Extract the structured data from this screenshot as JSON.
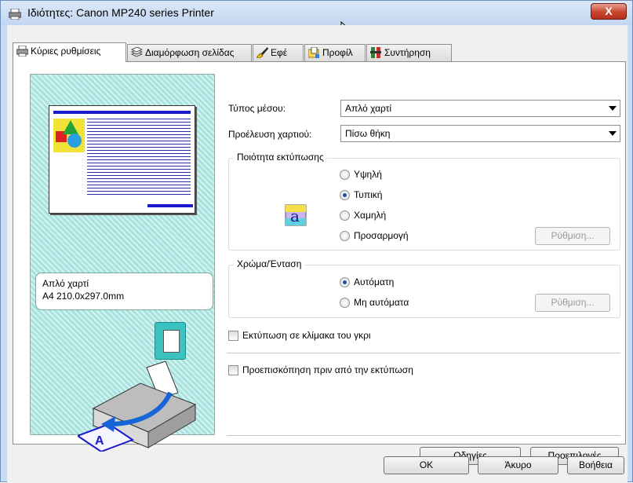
{
  "window": {
    "title": "Ιδιότητες: Canon MP240 series Printer",
    "close_label": "X"
  },
  "tabs": [
    {
      "label": "Κύριες ρυθμίσεις",
      "icon": "printer-icon"
    },
    {
      "label": "Διαμόρφωση σελίδας",
      "icon": "pages-icon"
    },
    {
      "label": "Εφέ",
      "icon": "brush-icon"
    },
    {
      "label": "Προφίλ",
      "icon": "folder-icon"
    },
    {
      "label": "Συντήρηση",
      "icon": "tools-icon"
    }
  ],
  "preview": {
    "media_name": "Απλό χαρτί",
    "media_size": "A4 210.0x297.0mm"
  },
  "settings": {
    "media_type_label": "Τύπος μέσου:",
    "media_type_value": "Απλό χαρτί",
    "paper_source_label": "Προέλευση χαρτιού:",
    "paper_source_value": "Πίσω θήκη"
  },
  "quality": {
    "title": "Ποιότητα εκτύπωσης",
    "options": [
      "Υψηλή",
      "Τυπική",
      "Χαμηλή",
      "Προσαρμογή"
    ],
    "selected": "Τυπική",
    "set_button": "Ρύθμιση..."
  },
  "color": {
    "title": "Χρώμα/Ένταση",
    "options": [
      "Αυτόματη",
      "Μη αυτόματα"
    ],
    "selected": "Αυτόματη",
    "set_button": "Ρύθμιση..."
  },
  "checks": {
    "grayscale_label": "Εκτύπωση σε κλίμακα του γκρι",
    "grayscale_checked": false,
    "preview_label": "Προεπισκόπηση πριν από την εκτύπωση",
    "preview_checked": false
  },
  "panel_buttons": {
    "instructions": "Οδηγίες",
    "defaults": "Προεπιλογές"
  },
  "dialog_buttons": {
    "ok": "OK",
    "cancel": "Άκυρο",
    "help": "Βοήθεια"
  }
}
